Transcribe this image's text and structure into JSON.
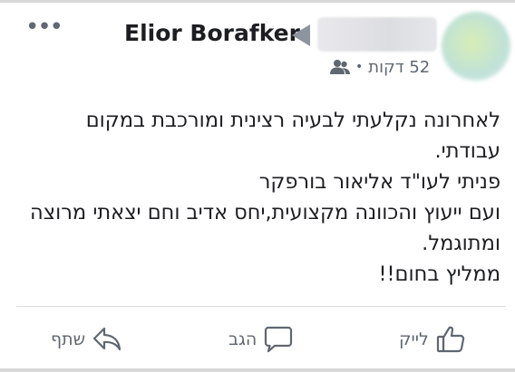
{
  "header": {
    "more_label": "•••",
    "author_name": "Elior Borafker",
    "time_ago": "52 דקות",
    "separator": "•"
  },
  "post": {
    "lines": [
      "לאחרונה נקלעתי לבעיה רצינית ומורכבת במקום",
      "עבודתי.",
      "פניתי לעו\"ד אליאור בורפקר",
      "ועם ייעוץ והכוונה מקצועית,יחס אדיב וחם יצאתי מרוצה",
      "ומתוגמל.",
      "ממליץ בחום!!"
    ]
  },
  "actions": {
    "share_label": "שתף",
    "comment_label": "הגב",
    "like_label": "לייק"
  },
  "icons": {
    "audience": "friends-icon",
    "share": "share-icon",
    "comment": "comment-icon",
    "like": "like-icon",
    "more": "more-options-icon"
  }
}
